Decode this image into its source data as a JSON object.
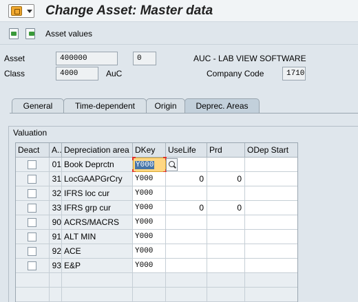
{
  "window": {
    "title": "Change Asset:  Master data"
  },
  "toolbar": {
    "asset_values_label": "Asset values"
  },
  "header": {
    "asset_label": "Asset",
    "asset_number": "400000",
    "asset_subnumber": "0",
    "asset_description": "AUC - LAB VIEW SOFTWARE",
    "class_label": "Class",
    "class_value": "4000",
    "class_text": "AuC",
    "company_code_label": "Company Code",
    "company_code_value": "1710"
  },
  "tabs": [
    {
      "label": "General",
      "active": false
    },
    {
      "label": "Time-dependent",
      "active": false
    },
    {
      "label": "Origin",
      "active": false
    },
    {
      "label": "Deprec. Areas",
      "active": true
    }
  ],
  "valuation": {
    "title": "Valuation",
    "columns": [
      "Deact",
      "A..",
      "Depreciation area",
      "DKey",
      "UseLife",
      "Prd",
      "ODep Start"
    ],
    "rows": [
      {
        "deact": false,
        "area_no": "01",
        "area_name": "Book Deprctn",
        "dkey": "Y000",
        "uselife": "",
        "prd": "",
        "odep_start": ""
      },
      {
        "deact": false,
        "area_no": "31",
        "area_name": "LocGAAPGrCry",
        "dkey": "Y000",
        "uselife": "0",
        "prd": "0",
        "odep_start": ""
      },
      {
        "deact": false,
        "area_no": "32",
        "area_name": "IFRS loc cur",
        "dkey": "Y000",
        "uselife": "",
        "prd": "",
        "odep_start": ""
      },
      {
        "deact": false,
        "area_no": "33",
        "area_name": "IFRS grp cur",
        "dkey": "Y000",
        "uselife": "0",
        "prd": "0",
        "odep_start": ""
      },
      {
        "deact": false,
        "area_no": "90",
        "area_name": "ACRS/MACRS",
        "dkey": "Y000",
        "uselife": "",
        "prd": "",
        "odep_start": ""
      },
      {
        "deact": false,
        "area_no": "91",
        "area_name": "ALT MIN",
        "dkey": "Y000",
        "uselife": "",
        "prd": "",
        "odep_start": ""
      },
      {
        "deact": false,
        "area_no": "92",
        "area_name": "ACE",
        "dkey": "Y000",
        "uselife": "",
        "prd": "",
        "odep_start": ""
      },
      {
        "deact": false,
        "area_no": "93",
        "area_name": "E&P",
        "dkey": "Y000",
        "uselife": "",
        "prd": "",
        "odep_start": ""
      }
    ]
  },
  "colors": {
    "focus_cell": "#ffd783",
    "selection": "#4674a8",
    "active_tab": "#c2d0db"
  }
}
